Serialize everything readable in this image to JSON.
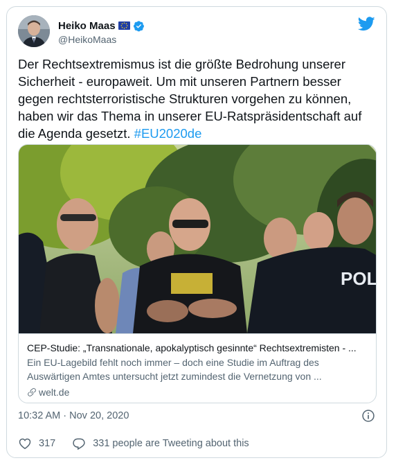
{
  "author": {
    "display_name": "Heiko Maas",
    "handle": "@HeikoMaas"
  },
  "tweet": {
    "text": "Der Rechtsextremismus ist die größte Bedrohung unserer Sicherheit - europaweit. Um mit unseren Partnern besser gegen rechtsterroristische Strukturen vorgehen zu können, haben wir das Thema in unserer EU-Ratspräsidentschaft auf die Agenda gesetzt. ",
    "hashtag": "#EU2020de"
  },
  "link_card": {
    "image_text": "POLIZ",
    "title": "CEP-Studie: „Transnationale, apokalyptisch gesinnte“ Rechtsextremisten - ...",
    "description": "Ein EU-Lagebild fehlt noch immer – doch eine Studie im Auftrag des Auswärtigen Amtes untersucht jetzt zumindest die Vernetzung von ...",
    "domain": "welt.de"
  },
  "timestamp": "10:32 AM · Nov 20, 2020",
  "actions": {
    "like_count": "317",
    "reply_text": "331 people are Tweeting about this"
  },
  "colors": {
    "accent": "#1d9bf0",
    "secondary_text": "#536471",
    "border": "#cfd9de"
  },
  "icons": [
    "eu-flag-icon",
    "verified-badge-icon",
    "twitter-logo-icon",
    "link-icon",
    "info-icon",
    "heart-icon",
    "reply-icon"
  ]
}
